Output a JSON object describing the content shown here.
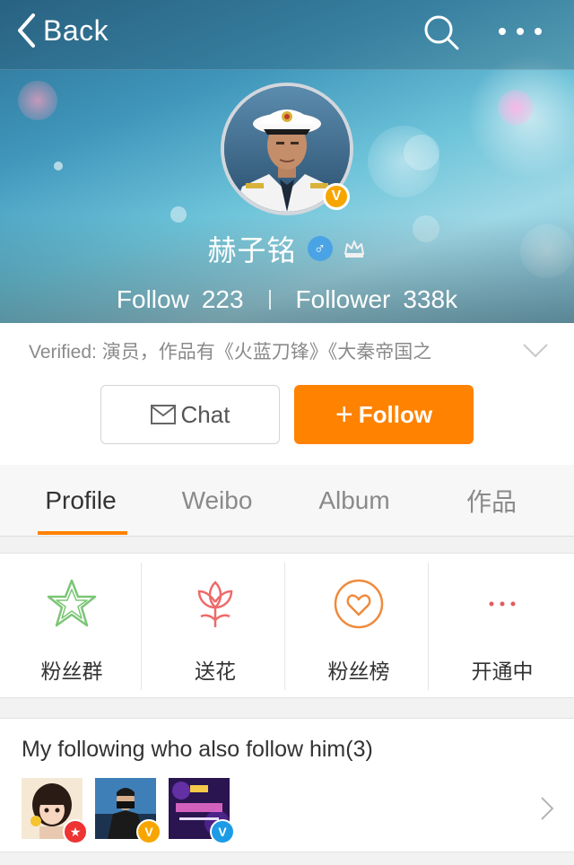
{
  "nav": {
    "back_label": "Back",
    "search_icon": "search-icon",
    "more_icon": "more-dots-icon"
  },
  "profile": {
    "name": "赫子铭",
    "gender_symbol": "♂",
    "verified_badge": "V",
    "follow_label": "Follow",
    "follow_count": "223",
    "follower_label": "Follower",
    "follower_count": "338k",
    "verified_text": "Verified: 演员，作品有《火蓝刀锋》《大秦帝国之"
  },
  "actions": {
    "chat_label": "Chat",
    "follow_button_label": "Follow",
    "follow_color": "#ff8200"
  },
  "tabs": [
    {
      "label": "Profile",
      "active": true
    },
    {
      "label": "Weibo",
      "active": false
    },
    {
      "label": "Album",
      "active": false
    },
    {
      "label": "作品",
      "active": false
    }
  ],
  "features": [
    {
      "label": "粉丝群",
      "icon": "star-icon",
      "color": "#7cc576"
    },
    {
      "label": "送花",
      "icon": "flower-icon",
      "color": "#ee6a6a"
    },
    {
      "label": "粉丝榜",
      "icon": "heart-circle-icon",
      "color": "#f08a3c"
    },
    {
      "label": "开通中",
      "icon": "dots-icon",
      "color": "#e25c5c"
    }
  ],
  "following": {
    "title": "My following who also follow him(3)",
    "users": [
      {
        "badge": "★",
        "badge_color": "#e33"
      },
      {
        "badge": "V",
        "badge_color": "#f7a600"
      },
      {
        "badge": "V",
        "badge_color": "#1d9be6"
      }
    ]
  }
}
